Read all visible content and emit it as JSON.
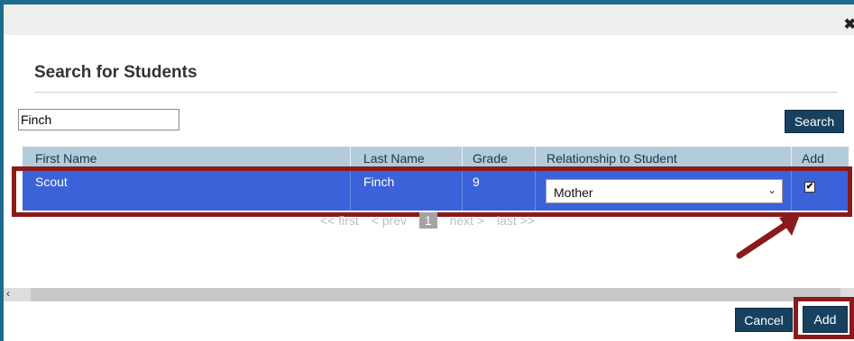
{
  "dialog": {
    "close_icon": "✖",
    "heading": "Search for Students"
  },
  "search": {
    "value": "Finch",
    "button_label": "Search"
  },
  "table": {
    "columns": [
      "First Name",
      "Last Name",
      "Grade",
      "Relationship to Student",
      "Add"
    ],
    "rows": [
      {
        "first_name": "Scout",
        "last_name": "Finch",
        "grade": "9",
        "relationship": "Mother",
        "add_checked": "✔"
      }
    ]
  },
  "pager": {
    "first": "<< first",
    "prev": "< prev",
    "current": "1",
    "next": "next >",
    "last": "last >>"
  },
  "footer": {
    "cancel_label": "Cancel",
    "add_label": "Add"
  },
  "colors": {
    "frame": "#1f6b8e",
    "header_row": "#b4cbdc",
    "selected_row": "#3b62d8",
    "button": "#17415f",
    "annotation": "#8b1a1a"
  }
}
